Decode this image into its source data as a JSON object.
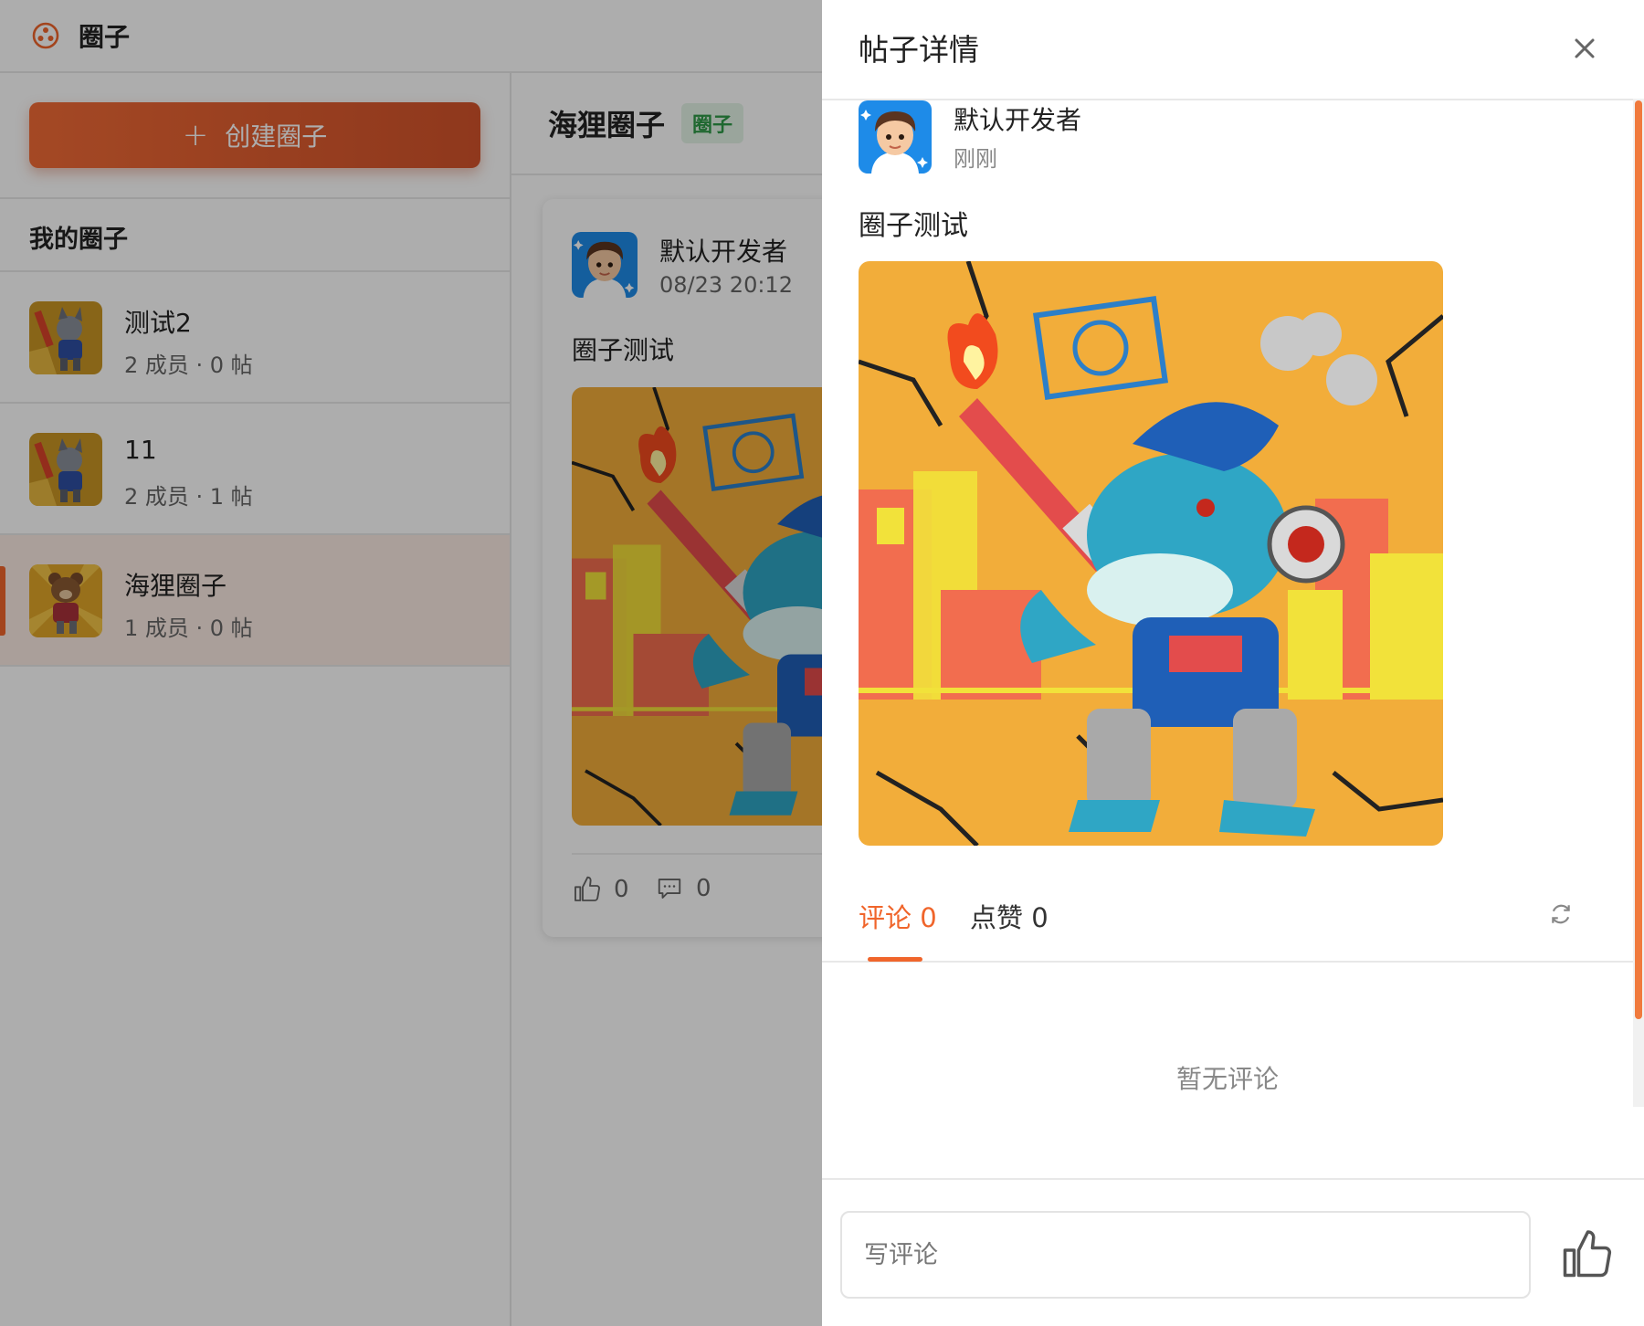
{
  "app": {
    "title": "圈子",
    "brand_color": "#f0652b"
  },
  "sidebar": {
    "create_label": "创建圈子",
    "section_title": "我的圈子",
    "items": [
      {
        "name": "测试2",
        "meta": "2 成员 · 0 帖",
        "thumb": "wolf-mech"
      },
      {
        "name": "11",
        "meta": "2 成员 · 1 帖",
        "thumb": "wolf-mech"
      },
      {
        "name": "海狸圈子",
        "meta": "1 成员 · 0 帖",
        "thumb": "bear-mech",
        "active": true
      }
    ]
  },
  "main": {
    "title": "海狸圈子",
    "tag": "圈子",
    "post": {
      "author": "默认开发者",
      "time": "08/23 20:12",
      "content": "圈子测试",
      "likes": "0",
      "comments": "0"
    }
  },
  "drawer": {
    "title": "帖子详情",
    "author": "默认开发者",
    "time": "刚刚",
    "content": "圈子测试",
    "tabs": [
      {
        "label": "评论 0",
        "active": true
      },
      {
        "label": "点赞 0",
        "active": false
      }
    ],
    "empty_text": "暂无评论",
    "comment_placeholder": "写评论"
  }
}
